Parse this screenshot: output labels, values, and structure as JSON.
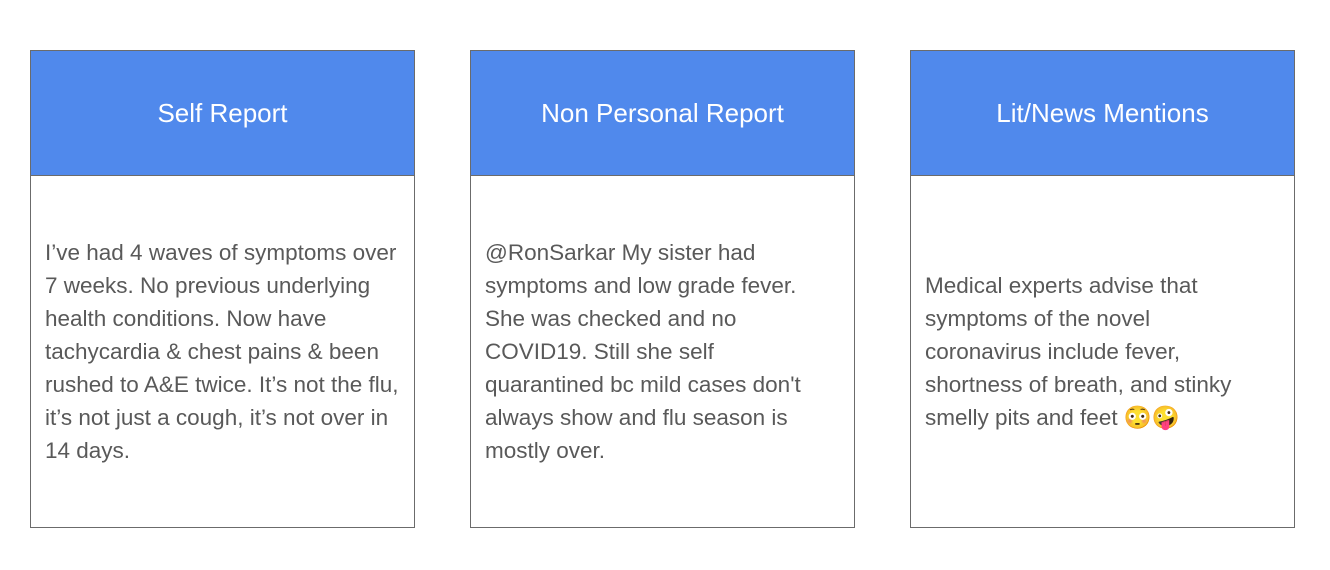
{
  "cards": [
    {
      "title": "Self Report",
      "text": "I’ve had 4 waves of symptoms over 7 weeks. No previous underlying health conditions. Now have tachycardia & chest pains & been rushed to A&E twice. It’s not the flu, it’s not just a cough, it’s not over in 14 days."
    },
    {
      "title": "Non Personal Report",
      "text": "@RonSarkar My sister had symptoms and low grade fever. She was checked and no COVID19. Still she self quarantined bc mild cases don't always show and flu season is mostly over."
    },
    {
      "title": "Lit/News Mentions",
      "text": "Medical experts advise that symptoms of the novel coronavirus include fever, shortness of breath, and stinky smelly pits and feet 😳🤪"
    }
  ],
  "colors": {
    "header_bg": "#5089ec",
    "header_text": "#ffffff",
    "body_text": "#595959",
    "border": "#6b6b6b"
  }
}
